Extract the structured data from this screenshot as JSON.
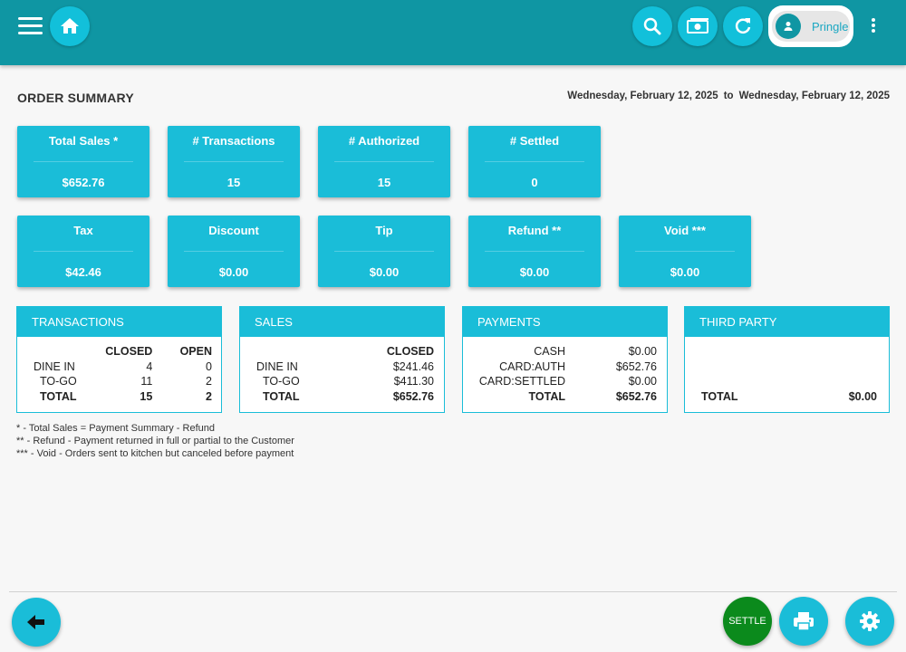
{
  "header": {
    "user_name": "Pringle",
    "icons": [
      "menu-icon",
      "home-icon",
      "search-icon",
      "cash-icon",
      "refresh-icon",
      "user-icon",
      "more-vert-icon"
    ]
  },
  "page": {
    "title": "ORDER SUMMARY",
    "date_from": "Wednesday, February 12, 2025",
    "date_to_word": "to",
    "date_to": "Wednesday, February 12, 2025"
  },
  "stats": {
    "total_sales": {
      "label": "Total Sales *",
      "value": "$652.76"
    },
    "transactions": {
      "label": "# Transactions",
      "value": "15"
    },
    "authorized": {
      "label": "# Authorized",
      "value": "15"
    },
    "settled": {
      "label": "# Settled",
      "value": "0"
    },
    "tax": {
      "label": "Tax",
      "value": "$42.46"
    },
    "discount": {
      "label": "Discount",
      "value": "$0.00"
    },
    "tip": {
      "label": "Tip",
      "value": "$0.00"
    },
    "refund": {
      "label": "Refund **",
      "value": "$0.00"
    },
    "void": {
      "label": "Void ***",
      "value": "$0.00"
    }
  },
  "transactions_panel": {
    "title": "TRANSACTIONS",
    "col_closed": "CLOSED",
    "col_open": "OPEN",
    "rows": [
      {
        "label": "DINE IN",
        "closed": "4",
        "open": "0"
      },
      {
        "label": "TO-GO",
        "closed": "11",
        "open": "2"
      },
      {
        "label": "TOTAL",
        "closed": "15",
        "open": "2"
      }
    ]
  },
  "sales_panel": {
    "title": "SALES",
    "col_closed": "CLOSED",
    "rows": [
      {
        "label": "DINE IN",
        "closed": "$241.46"
      },
      {
        "label": "TO-GO",
        "closed": "$411.30"
      },
      {
        "label": "TOTAL",
        "closed": "$652.76"
      }
    ]
  },
  "payments_panel": {
    "title": "PAYMENTS",
    "rows": [
      {
        "label": "CASH",
        "value": "$0.00"
      },
      {
        "label": "CARD:AUTH",
        "value": "$652.76"
      },
      {
        "label": "CARD:SETTLED",
        "value": "$0.00"
      },
      {
        "label": "TOTAL",
        "value": "$652.76"
      }
    ]
  },
  "third_party_panel": {
    "title": "THIRD PARTY",
    "total_label": "TOTAL",
    "total_value": "$0.00"
  },
  "notes": [
    "* - Total Sales = Payment Summary - Refund",
    "** - Refund - Payment returned in full or partial to the Customer",
    "*** - Void - Orders sent to kitchen but canceled before payment"
  ],
  "footer": {
    "settle_label": "SETTLE",
    "icons": [
      "back-arrow-icon",
      "print-icon",
      "gear-icon"
    ]
  },
  "colors": {
    "topbar": "#0f96a3",
    "accent": "#1abdd8",
    "settle": "#0b8a1c"
  }
}
